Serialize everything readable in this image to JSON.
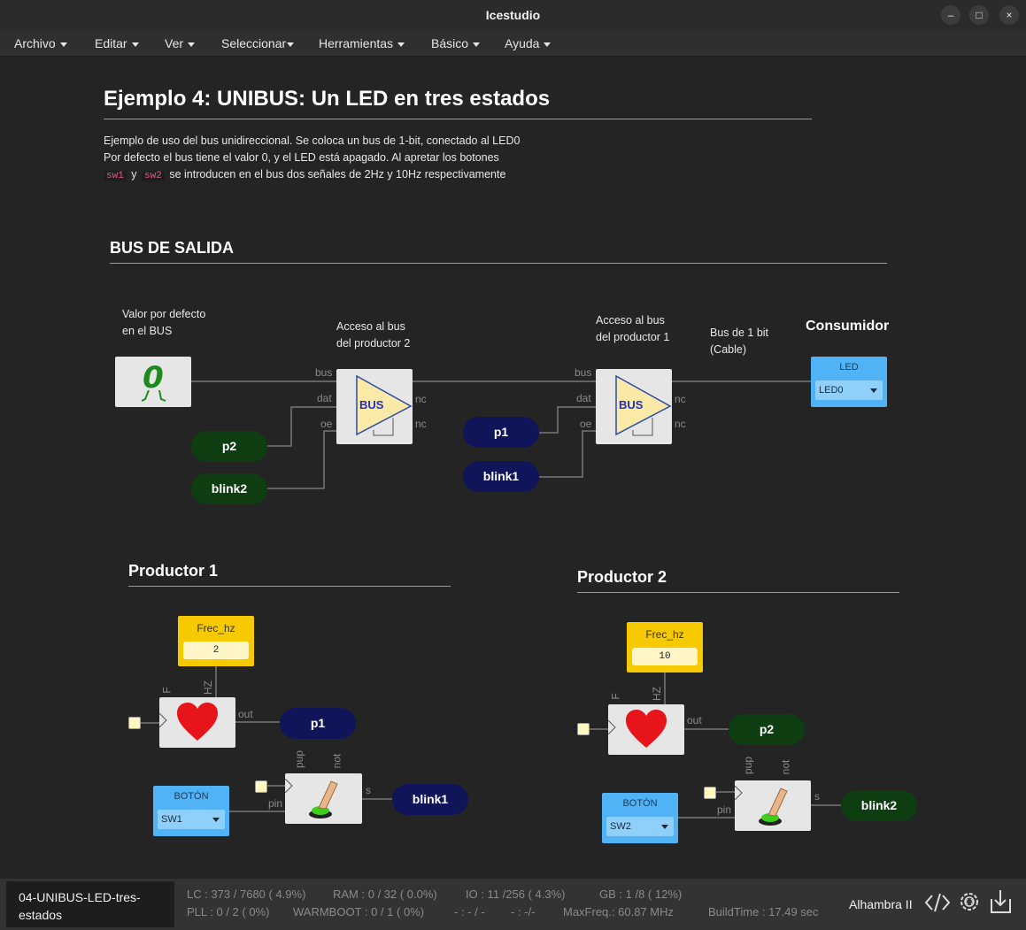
{
  "window": {
    "title": "Icestudio",
    "minimize": "–",
    "maximize": "□",
    "close": "×"
  },
  "menu": [
    {
      "label": "Archivo"
    },
    {
      "label": "Editar"
    },
    {
      "label": "Ver"
    },
    {
      "label": "Seleccionar"
    },
    {
      "label": "Herramientas"
    },
    {
      "label": "Básico"
    },
    {
      "label": "Ayuda"
    }
  ],
  "doc": {
    "title": "Ejemplo 4: UNIBUS: Un LED en tres estados",
    "line1": "Ejemplo de uso del bus unidireccional. Se coloca un bus de 1-bit, conectado al LED0",
    "line2": "Por defecto el bus tiene el valor 0, y el LED está apagado. Al apretar los botones",
    "code1": "sw1",
    "and": "y",
    "code2": "sw2",
    "line3_rest": "se introducen en el bus dos señales de 2Hz y 10Hz respectivamente"
  },
  "bus_section": {
    "heading": "BUS DE SALIDA",
    "note_default_1": "Valor por defecto",
    "note_default_2": "en el BUS",
    "note_p2_1": "Acceso al bus",
    "note_p2_2": "del productor 2",
    "note_p1_1": "Acceso al bus",
    "note_p1_2": "del productor 1",
    "note_cable_1": "Bus de 1 bit",
    "note_cable_2": "(Cable)",
    "note_consumer": "Consumidor",
    "const_value": "0",
    "bus_block_label": "BUS",
    "ports": {
      "bus": "bus",
      "dat": "dat",
      "oe": "oe",
      "nc": "nc"
    },
    "led": {
      "name": "LED",
      "value": "LED0"
    },
    "labels": {
      "p2": "p2",
      "blink2": "blink2",
      "p1": "p1",
      "blink1": "blink1"
    }
  },
  "productor1": {
    "heading": "Productor 1",
    "const_name": "Frec_hz",
    "const_value": "2",
    "ports": {
      "f": "F",
      "hz": "HZ",
      "out": "out",
      "pup": "pup",
      "not": "not",
      "pin": "pin",
      "s": "s"
    },
    "out_label": "p1",
    "button": {
      "name": "BOTÓN",
      "value": "SW1"
    },
    "s_label": "blink1"
  },
  "productor2": {
    "heading": "Productor 2",
    "const_name": "Frec_hz",
    "const_value": "10",
    "ports": {
      "f": "F",
      "hz": "HZ",
      "out": "out",
      "pup": "pup",
      "not": "not",
      "pin": "pin",
      "s": "s"
    },
    "out_label": "p2",
    "button": {
      "name": "BOTÓN",
      "value": "SW2"
    },
    "s_label": "blink2"
  },
  "status": {
    "file": "04-UNIBUS-LED-tres-estados",
    "lc": "LC : 373 / 7680 ( 4.9%)",
    "ram": "RAM : 0 / 32 ( 0.0%)",
    "io": "IO :  11 /256  ( 4.3%)",
    "gb": "GB :  1 /8  ( 12%)",
    "pll": "PLL : 0 / 2 ( 0%)",
    "warmboot": "WARMBOOT : 0 / 1 ( 0%)",
    "x1": "- : - / -",
    "x2": "- :  -/-",
    "maxfreq": "MaxFreq.:  60.87 MHz",
    "buildtime": "BuildTime :  17.49 sec",
    "board": "Alhambra II"
  },
  "colors": {
    "navy": "#10155a",
    "green": "#0f3d12",
    "const": "#f7c900",
    "io": "#4fb3f6",
    "bus_triangle": "#fbe9a8"
  }
}
